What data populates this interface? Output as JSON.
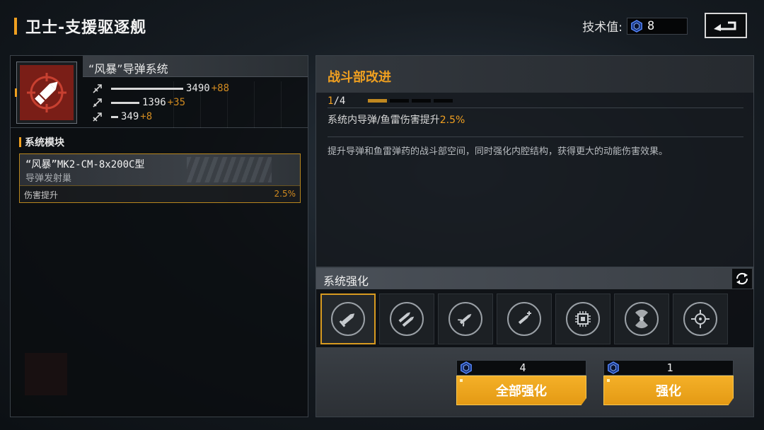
{
  "header": {
    "title": "卫士-支援驱逐舰",
    "tech_label": "技术值:",
    "tech_value": "8",
    "back_icon": "back-arrow-icon"
  },
  "system": {
    "name": "“风暴”导弹系统",
    "icon": "missile-icon",
    "stats": [
      {
        "icon": "attack-icon",
        "value": "3490",
        "bonus": "+88",
        "fill": 1.0
      },
      {
        "icon": "range-icon",
        "value": "1396",
        "bonus": "+35",
        "fill": 0.4
      },
      {
        "icon": "speed-icon",
        "value": "349",
        "bonus": "+8",
        "fill": 0.1
      }
    ]
  },
  "modules": {
    "title": "系统模块",
    "item": {
      "name": "“风暴”MK2-CM-8x200C型",
      "sub": "导弹发射巢",
      "effect_label": "伤害提升",
      "effect_value": "2.5%"
    }
  },
  "detail": {
    "title": "战斗部改进",
    "level_current": "1",
    "level_max": "/4",
    "level_num": 1,
    "level_total": 4,
    "effect_prefix": "系统内导弹/鱼雷伤害提升",
    "effect_value": "2.5%",
    "description": "提升导弹和鱼雷弹药的战斗部空间，同时强化内腔结构，获得更大的动能伤害效果。"
  },
  "enhance": {
    "title": "系统强化",
    "refresh_icon": "refresh-icon",
    "slots": [
      {
        "icon": "warhead-icon",
        "active": true
      },
      {
        "icon": "twin-missile-icon",
        "active": false
      },
      {
        "icon": "guided-missile-icon",
        "active": false
      },
      {
        "icon": "missile-boost-icon",
        "active": false
      },
      {
        "icon": "chip-icon",
        "active": false
      },
      {
        "icon": "radar-icon",
        "active": false
      },
      {
        "icon": "target-lock-icon",
        "active": false
      }
    ],
    "all_cost": "4",
    "all_label": "全部强化",
    "single_cost": "1",
    "single_label": "强化"
  },
  "colors": {
    "accent": "#f0a020",
    "button": "#e9a21a",
    "system_icon_bg": "#7a1e17"
  }
}
